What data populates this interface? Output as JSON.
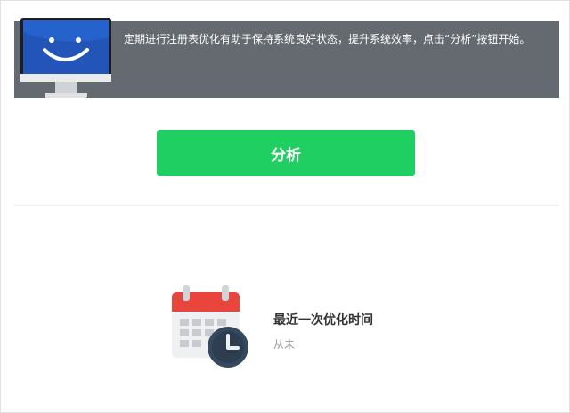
{
  "banner": {
    "message": "定期进行注册表优化有助于保持系统良好状态，提升系统效率，点击“分析”按钮开始。",
    "icon": "smiley-monitor-icon"
  },
  "actions": {
    "analyze_label": "分析"
  },
  "last_optimization": {
    "title": "最近一次优化时间",
    "value": "从未",
    "icon": "calendar-clock-icon"
  },
  "colors": {
    "banner_bg": "#646a70",
    "primary_button": "#1fcf61",
    "calendar_red": "#e8463c",
    "clock_navy": "#34495e"
  }
}
